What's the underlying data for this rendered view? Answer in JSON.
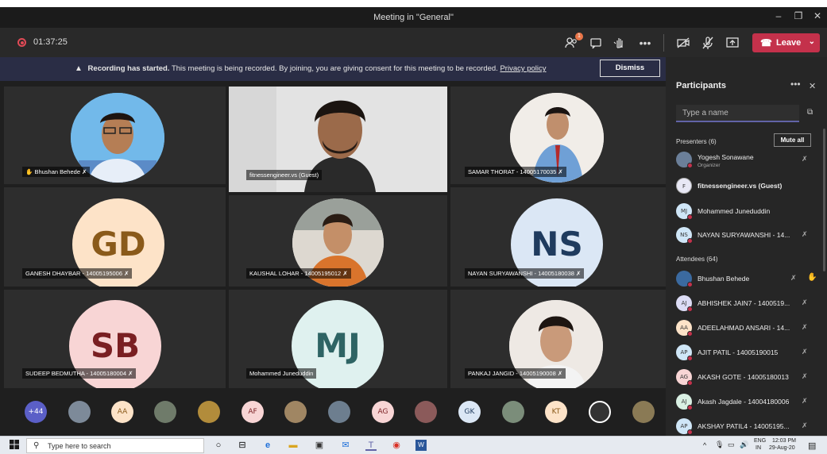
{
  "window": {
    "title": "Meeting in \"General\"",
    "minimize": "–",
    "restore": "❐",
    "close": "✕"
  },
  "toolbar": {
    "timer": "01:37:25",
    "participants_badge": "1",
    "leave_label": "Leave",
    "leave_color": "#c4314b"
  },
  "banner": {
    "bold": "Recording has started.",
    "text": "This meeting is being recorded. By joining, you are giving consent for this meeting to be recorded.",
    "link": "Privacy policy",
    "dismiss": "Dismiss"
  },
  "tiles": [
    {
      "label": "Bhushan Behede",
      "raised_hand": true,
      "kind": "photo"
    },
    {
      "label": "fitnessengineer.vs (Guest)",
      "kind": "video"
    },
    {
      "label": "SAMAR THORAT - 14005170035",
      "kind": "photo"
    },
    {
      "label": "GANESH DHAYBAR - 14005195006",
      "initials": "GD",
      "bg": "#fde3c8",
      "fg": "#8a5a1a"
    },
    {
      "label": "KAUSHAL LOHAR - 14005195012",
      "kind": "photo"
    },
    {
      "label": "NAYAN SURYAWANSHI - 14005180038",
      "initials": "NS",
      "bg": "#dbe7f5",
      "fg": "#1f3b5e"
    },
    {
      "label": "SUDEEP BEDMUTHA - 14005180004",
      "initials": "SB",
      "bg": "#f8d5d5",
      "fg": "#7a1f22"
    },
    {
      "label": "Mohammed Juneduddin",
      "initials": "MJ",
      "bg": "#dff1ef",
      "fg": "#2e6464"
    },
    {
      "label": "PANKAJ JANGID - 14005190008",
      "kind": "photo"
    }
  ],
  "tray": [
    {
      "text": "+44",
      "bg": "#5b5fc7",
      "fg": "#ffffff"
    },
    {
      "text": "",
      "bg": "#7d8a99"
    },
    {
      "text": "AA",
      "bg": "#fde3c8",
      "fg": "#8a5a1a"
    },
    {
      "text": "",
      "bg": "#6f7b6a"
    },
    {
      "text": "",
      "bg": "#b28c3b"
    },
    {
      "text": "AF",
      "bg": "#f8d5d5",
      "fg": "#7a1f22"
    },
    {
      "text": "",
      "bg": "#a08663"
    },
    {
      "text": "",
      "bg": "#6d7e8f"
    },
    {
      "text": "AG",
      "bg": "#f8d5d5",
      "fg": "#7a1f22"
    },
    {
      "text": "",
      "bg": "#8b5a5a"
    },
    {
      "text": "GK",
      "bg": "#dbe7f5",
      "fg": "#1f3b5e"
    },
    {
      "text": "",
      "bg": "#7b8d7a"
    },
    {
      "text": "KT",
      "bg": "#fde3c8",
      "fg": "#8a5a1a"
    },
    {
      "text": "",
      "bg": "#333333"
    },
    {
      "text": "",
      "bg": "#8a7a55"
    }
  ],
  "panel": {
    "title": "Participants",
    "more": "•••",
    "close": "✕",
    "search_placeholder": "Type a name",
    "presenters_header": "Presenters (6)",
    "mute_all": "Mute all",
    "attendees_header": "Attendees (64)",
    "presenters": [
      {
        "name": "Yogesh Sonawane",
        "sub": "Organizer",
        "initials": "",
        "bg": "#6b7f99",
        "muted": true
      },
      {
        "name": "fitnessengineer.vs (Guest)",
        "initials": "F",
        "bg": "#e8e8f5",
        "bold": true
      },
      {
        "name": "Mohammed Juneduddin",
        "initials": "MJ",
        "bg": "#cfe6f7",
        "reddot": true
      },
      {
        "name": "NAYAN SURYAWANSHI - 14...",
        "initials": "NS",
        "bg": "#cfe6f7",
        "reddot": true,
        "muted": true
      }
    ],
    "attendees": [
      {
        "name": "Bhushan Behede",
        "initials": "",
        "bg": "#3b6aa0",
        "muted": true,
        "hand": true
      },
      {
        "name": "ABHISHEK JAIN7 - 1400519...",
        "initials": "AJ",
        "bg": "#dcdcf5",
        "reddot": true,
        "muted": true
      },
      {
        "name": "ADEELAHMAD ANSARI - 14...",
        "initials": "AA",
        "bg": "#fde3c8",
        "reddot": true,
        "muted": true
      },
      {
        "name": "AJIT PATIL - 14005190015",
        "initials": "AP",
        "bg": "#cfe6f7",
        "reddot": true,
        "muted": true
      },
      {
        "name": "AKASH GOTE - 14005180013",
        "initials": "AG",
        "bg": "#f8d5d5",
        "reddot": true,
        "muted": true
      },
      {
        "name": "Akash Jagdale - 14004180006",
        "initials": "AJ",
        "bg": "#d9f0e3",
        "reddot": true,
        "muted": true
      },
      {
        "name": "AKSHAY PATIL4 - 14005195...",
        "initials": "AP",
        "bg": "#cfe6f7",
        "reddot": true,
        "muted": true
      }
    ]
  },
  "taskbar": {
    "search_placeholder": "Type here to search",
    "lang": "ENG",
    "region": "IN",
    "time": "12:03 PM",
    "date": "29-Aug-20"
  }
}
